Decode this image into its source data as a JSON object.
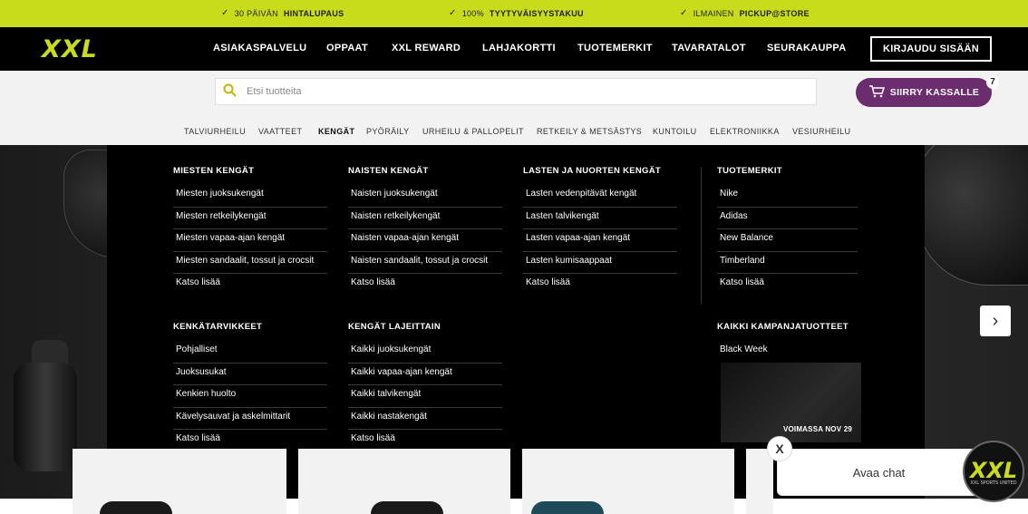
{
  "promo_bar": {
    "items": [
      {
        "prefix": "30 PÄIVÄN",
        "bold": "HINTALUPAUS"
      },
      {
        "prefix": "100%",
        "bold": "TYYTYVÄISYYSTAKUU"
      },
      {
        "prefix": "ILMAINEN",
        "bold": "PICKUP@STORE"
      }
    ]
  },
  "header": {
    "logo": "XXL",
    "nav": [
      "ASIAKASPALVELU",
      "OPPAAT",
      "XXL REWARD",
      "LAHJAKORTTI",
      "TUOTEMERKIT",
      "TAVARATALOT",
      "SEURAKAUPPA"
    ],
    "login_label": "KIRJAUDU SISÄÄN"
  },
  "search": {
    "placeholder": "Etsi tuotteita",
    "icon": "search-icon"
  },
  "cart": {
    "label": "SIIRRY KASSALLE",
    "count": "7",
    "icon": "cart-icon",
    "color": "#6b2d6e"
  },
  "categories": [
    "TALVIURHEILU",
    "VAATTEET",
    "KENGÄT",
    "PYÖRÄILY",
    "URHEILU & PALLOPELIT",
    "RETKEILY & METSÄSTYS",
    "KUNTOILU",
    "ELEKTRONIIKKA",
    "VESIURHEILU"
  ],
  "active_category": "KENGÄT",
  "mega_menu": {
    "columns": [
      {
        "title": "MIESTEN KENGÄT",
        "links": [
          "Miesten juoksukengät",
          "Miesten retkeilykengät",
          "Miesten vapaa-ajan kengät",
          "Miesten sandaalit, tossut ja crocsit",
          "Katso lisää"
        ]
      },
      {
        "title": "NAISTEN KENGÄT",
        "links": [
          "Naisten juoksukengät",
          "Naisten retkeilykengät",
          "Naisten vapaa-ajan kengät",
          "Naisten sandaalit, tossut ja crocsit",
          "Katso lisää"
        ]
      },
      {
        "title": "LASTEN JA NUORTEN KENGÄT",
        "links": [
          "Lasten vedenpitävät kengät",
          "Lasten talvikengät",
          "Lasten vapaa-ajan kengät",
          "Lasten kumisaappaat",
          "Katso lisää"
        ]
      },
      {
        "title": "TUOTEMERKIT",
        "links": [
          "Nike",
          "Adidas",
          "New Balance",
          "Timberland",
          "Katso lisää"
        ]
      },
      {
        "title": "KENKÄTARVIKKEET",
        "links": [
          "Pohjalliset",
          "Juoksusukat",
          "Kenkien huolto",
          "Kävelysauvat ja askelmittarit",
          "Katso lisää"
        ]
      },
      {
        "title": "KENGÄT LAJEITTAIN",
        "links": [
          "Kaikki juoksukengät",
          "Kaikki vapaa-ajan kengät",
          "Kaikki talvikengät",
          "Kaikki nastakengät",
          "Katso lisää"
        ]
      },
      {
        "title": "KAIKKI KAMPANJATUOTTEET",
        "links": [
          "Black Week"
        ]
      }
    ],
    "promo_label": "VOIMASSA NOV 29"
  },
  "chat": {
    "label": "Avaa chat",
    "close": "X",
    "logo": "XXL",
    "logo_sub": "XXL SPORTS UNITED"
  },
  "colors": {
    "accent": "#c9dc1c",
    "nav_bg": "#000000"
  }
}
